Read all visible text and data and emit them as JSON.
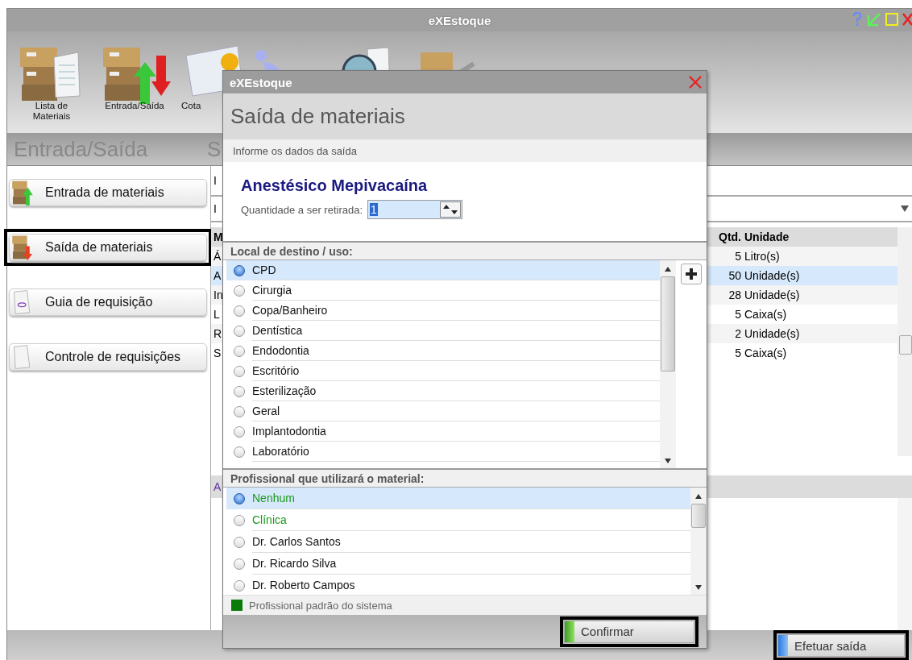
{
  "window": {
    "title": "eXEstoque"
  },
  "toolbar": [
    {
      "label": "Lista de Materiais",
      "kind": "boxes-document"
    },
    {
      "label": "Entrada/Saída",
      "kind": "boxes-arrows"
    },
    {
      "label": "Cota",
      "kind": "document-dollar"
    },
    {
      "kind": "figure"
    },
    {
      "kind": "magnifier-document"
    },
    {
      "kind": "box-pen"
    }
  ],
  "section": {
    "title": "Entrada/Saída",
    "second_title": "S"
  },
  "sidebar": {
    "items": [
      {
        "label": "Entrada de materiais",
        "kind": "boxes-up",
        "highlighted": false
      },
      {
        "label": "Saída de materiais",
        "kind": "boxes-down",
        "highlighted": true
      },
      {
        "label": "Guia de requisição",
        "kind": "document-purple",
        "highlighted": false
      },
      {
        "label": "Controle de requisições",
        "kind": "document",
        "highlighted": false
      }
    ]
  },
  "main": {
    "labels": [
      "I",
      "I"
    ],
    "table": {
      "columns": [
        "M",
        "Qtd.",
        "Unidade"
      ],
      "rows": [
        {
          "column_1": "Á",
          "qtd": "5",
          "unidade": "Litro(s)",
          "selected": false
        },
        {
          "column_1": "A",
          "qtd": "50",
          "unidade": "Unidade(s)",
          "selected": true
        },
        {
          "column_1": "In",
          "qtd": "28",
          "unidade": "Unidade(s)",
          "selected": false
        },
        {
          "column_1": "L",
          "qtd": "5",
          "unidade": "Caixa(s)",
          "selected": false
        },
        {
          "column_1": "R",
          "qtd": "2",
          "unidade": "Unidade(s)",
          "selected": false
        },
        {
          "column_1": "S",
          "qtd": "5",
          "unidade": "Caixa(s)",
          "selected": false
        }
      ]
    },
    "lower_panel": {
      "title": "A"
    }
  },
  "action_button": {
    "label": "Efetuar saída",
    "highlighted": true
  },
  "dialog": {
    "title": "eXEstoque",
    "heading": "Saída de materiais",
    "subheading": "Informe os dados da saída",
    "product": "Anestésico Mepivacaína",
    "quantity_label": "Quantidade a ser retirada:",
    "quantity": "1",
    "destination": {
      "title": "Local de destino / uso:",
      "items": [
        {
          "label": "CPD",
          "selected": true
        },
        {
          "label": "Cirurgia",
          "selected": false
        },
        {
          "label": "Copa/Banheiro",
          "selected": false
        },
        {
          "label": "Dentística",
          "selected": false
        },
        {
          "label": "Endodontia",
          "selected": false
        },
        {
          "label": "Escritório",
          "selected": false
        },
        {
          "label": "Esterilização",
          "selected": false
        },
        {
          "label": "Geral",
          "selected": false
        },
        {
          "label": "Implantodontia",
          "selected": false
        },
        {
          "label": "Laboratório",
          "selected": false
        }
      ]
    },
    "professional": {
      "title": "Profissional que utilizará o material:",
      "items": [
        {
          "label": "Nenhum",
          "selected": true,
          "system_default": true
        },
        {
          "label": "Clínica",
          "selected": false,
          "system_default": true
        },
        {
          "label": "Dr. Carlos Santos",
          "selected": false,
          "system_default": false
        },
        {
          "label": "Dr. Ricardo Silva",
          "selected": false,
          "system_default": false
        },
        {
          "label": "Dr. Roberto Campos",
          "selected": false,
          "system_default": false
        }
      ]
    },
    "legend": "Profissional padrão do sistema",
    "confirm": {
      "label": "Confirmar",
      "highlighted": true
    }
  }
}
